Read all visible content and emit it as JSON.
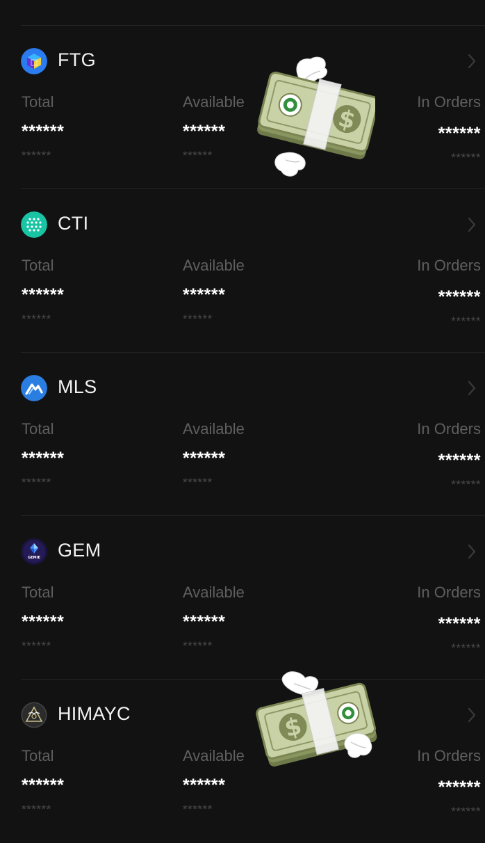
{
  "columns": {
    "total": "Total",
    "available": "Available",
    "in_orders": "In Orders"
  },
  "masked": {
    "value": "******",
    "sub": "******"
  },
  "assets": [
    {
      "name": "FTG",
      "icon": "ftg-cube-icon",
      "icon_color": "#2b7cf0"
    },
    {
      "name": "CTI",
      "icon": "cti-dots-icon",
      "icon_color": "#19c4a4"
    },
    {
      "name": "MLS",
      "icon": "mls-logo-icon",
      "icon_color": "#2a7de1"
    },
    {
      "name": "GEM",
      "icon": "gemie-logo-icon",
      "icon_color": "#1b1440"
    },
    {
      "name": "HIMAYC",
      "icon": "himayc-logo-icon",
      "icon_color": "#2b2b2b"
    }
  ],
  "stickers": [
    {
      "icon": "money-with-wings-icon"
    },
    {
      "icon": "money-with-wings-icon"
    }
  ],
  "colors": {
    "background": "#121212",
    "label": "#5f5f5f",
    "value": "#ffffff",
    "sub": "#4a4a4a",
    "divider": "#262626"
  }
}
